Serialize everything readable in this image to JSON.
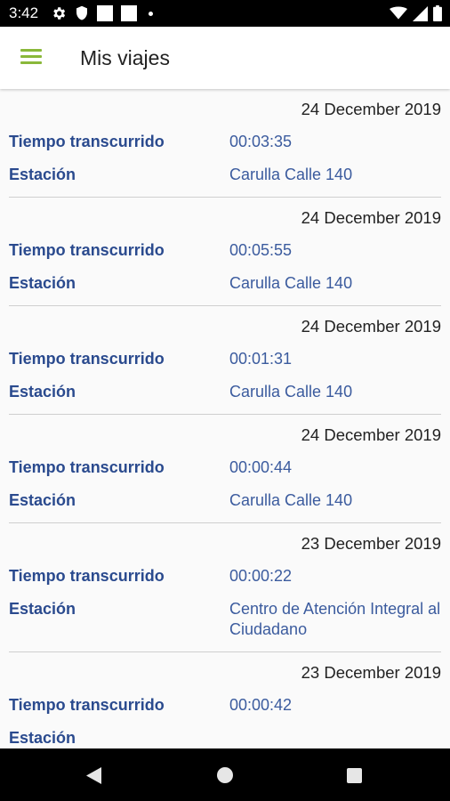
{
  "status_bar": {
    "time": "3:42",
    "icons": [
      "gear-icon",
      "shield-icon",
      "square-icon",
      "square-icon",
      "dot-icon",
      "wifi-icon",
      "signal-icon",
      "battery-icon"
    ]
  },
  "app_bar": {
    "title": "Mis viajes",
    "menu_icon": "hamburger-icon",
    "accent_color": "#8ab83a"
  },
  "trips": [
    {
      "date": "24 December 2019",
      "elapsed_label": "Tiempo transcurrido",
      "elapsed": "00:03:35",
      "station_label": "Estación",
      "station": "Carulla Calle 140"
    },
    {
      "date": "24 December 2019",
      "elapsed_label": "Tiempo transcurrido",
      "elapsed": "00:05:55",
      "station_label": "Estación",
      "station": "Carulla Calle 140"
    },
    {
      "date": "24 December 2019",
      "elapsed_label": "Tiempo transcurrido",
      "elapsed": "00:01:31",
      "station_label": "Estación",
      "station": "Carulla Calle 140"
    },
    {
      "date": "24 December 2019",
      "elapsed_label": "Tiempo transcurrido",
      "elapsed": "00:00:44",
      "station_label": "Estación",
      "station": "Carulla Calle 140"
    },
    {
      "date": "23 December 2019",
      "elapsed_label": "Tiempo transcurrido",
      "elapsed": "00:00:22",
      "station_label": "Estación",
      "station": "Centro de Atención Integral al Ciudadano"
    },
    {
      "date": "23 December 2019",
      "elapsed_label": "Tiempo transcurrido",
      "elapsed": "00:00:42",
      "station_label": "Estación",
      "station": ""
    }
  ],
  "nav_bar": {
    "back_icon": "back-triangle-icon",
    "home_icon": "home-circle-icon",
    "recent_icon": "recent-apps-square-icon"
  },
  "colors": {
    "label": "#2a4a8e",
    "value": "#3b5b9e",
    "divider": "#cfcfcf"
  }
}
